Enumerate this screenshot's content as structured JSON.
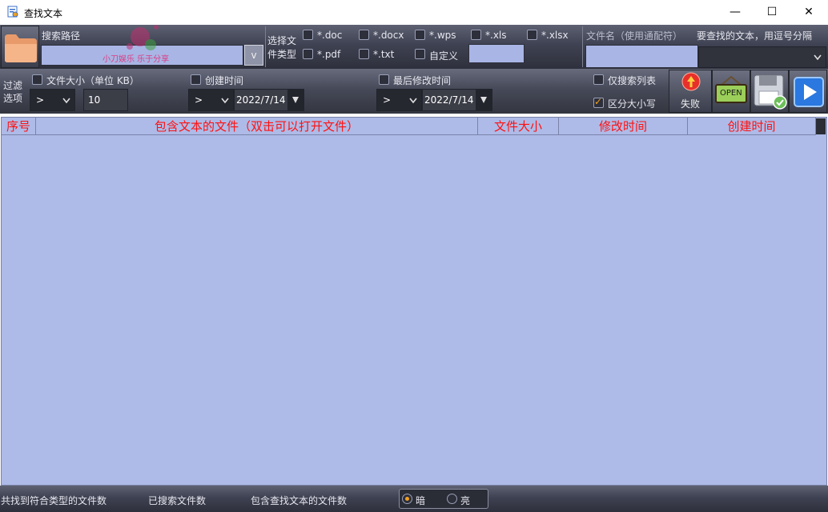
{
  "window": {
    "title": "查找文本",
    "minimize": "—",
    "maximize": "☐",
    "close": "✕"
  },
  "search_path": {
    "label": "搜索路径",
    "value": "",
    "dropdown": "v"
  },
  "watermark": "小刀娱乐 乐于分享",
  "file_types": {
    "label_line1": "选择文",
    "label_line2": "件类型",
    "options": [
      {
        "label": "*.doc",
        "checked": false
      },
      {
        "label": "*.docx",
        "checked": false
      },
      {
        "label": "*.wps",
        "checked": false
      },
      {
        "label": "*.xls",
        "checked": false
      },
      {
        "label": "*.xlsx",
        "checked": false
      },
      {
        "label": "*.pdf",
        "checked": false
      },
      {
        "label": "*.txt",
        "checked": false
      },
      {
        "label": "自定义",
        "checked": false
      }
    ],
    "custom_value": ""
  },
  "filename": {
    "label": "文件名（使用通配符）",
    "value": ""
  },
  "search_text": {
    "label": "要查找的文本，用逗号分隔",
    "value": ""
  },
  "filter": {
    "label_line1": "过滤",
    "label_line2": "选项",
    "size": {
      "label": "文件大小（单位 KB）",
      "op": ">",
      "value": "10"
    },
    "created": {
      "label": "创建时间",
      "op": ">",
      "date": "2022/7/14"
    },
    "modified": {
      "label": "最后修改时间",
      "op": ">",
      "date": "2022/7/14"
    },
    "only_list": {
      "label": "仅搜索列表",
      "checked": false
    },
    "case_sensitive": {
      "label": "区分大小写",
      "checked": true
    }
  },
  "buttons": {
    "fail": "失败",
    "open": "OPEN"
  },
  "table": {
    "columns": [
      "序号",
      "包含文本的文件（双击可以打开文件）",
      "文件大小",
      "修改时间",
      "创建时间"
    ],
    "rows": []
  },
  "status": {
    "matched": "共找到符合类型的文件数",
    "searched": "已搜索文件数",
    "contains": "包含查找文本的文件数",
    "theme_dark": "暗",
    "theme_light": "亮"
  },
  "colors": {
    "header_text": "#ff1010",
    "table_bg": "#aebbe8",
    "accent": "#f0a020"
  }
}
